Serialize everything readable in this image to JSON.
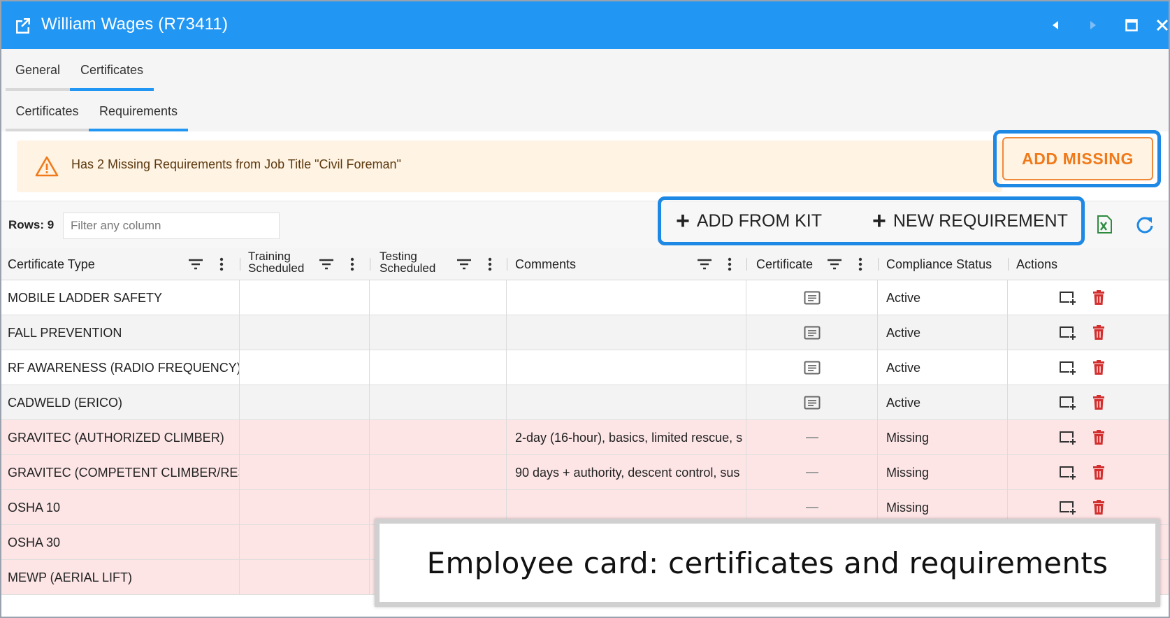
{
  "window": {
    "title": "William Wages (R73411)",
    "open_icon": "open-in-new-icon",
    "controls": [
      "prev-record-icon",
      "next-record-icon",
      "maximize-icon",
      "close-icon"
    ]
  },
  "tabs": {
    "top": [
      {
        "label": "General",
        "active": false
      },
      {
        "label": "Certificates",
        "active": true
      }
    ],
    "sub": [
      {
        "label": "Certificates",
        "active": false
      },
      {
        "label": "Requirements",
        "active": true
      }
    ]
  },
  "alert": {
    "icon": "warning-icon",
    "message": "Has 2 Missing Requirements from Job Title \"Civil Foreman\"",
    "action_label": "ADD MISSING",
    "colors": {
      "background": "#fff3e3",
      "accent": "#f07a1a"
    }
  },
  "toolbar": {
    "rows_label": "Rows: 9",
    "filter_placeholder": "Filter any column",
    "add_from_kit_label": "ADD FROM KIT",
    "new_requirement_label": "NEW REQUIREMENT",
    "export_icon": "excel-export-icon",
    "refresh_icon": "refresh-icon"
  },
  "table": {
    "headers": {
      "certificate_type": "Certificate Type",
      "training_line1": "Training",
      "training_line2": "Scheduled",
      "testing_line1": "Testing",
      "testing_line2": "Scheduled",
      "comments": "Comments",
      "certificate": "Certificate",
      "compliance_status": "Compliance Status",
      "actions": "Actions"
    },
    "rows": [
      {
        "certificate_type": "MOBILE LADDER SAFETY",
        "training": "",
        "testing": "",
        "comments": "",
        "certificate": "document-icon",
        "status": "Active"
      },
      {
        "certificate_type": "FALL PREVENTION",
        "training": "",
        "testing": "",
        "comments": "",
        "certificate": "document-icon",
        "status": "Active"
      },
      {
        "certificate_type": "RF AWARENESS (RADIO FREQUENCY)",
        "training": "",
        "testing": "",
        "comments": "",
        "certificate": "document-icon",
        "status": "Active"
      },
      {
        "certificate_type": "CADWELD (ERICO)",
        "training": "",
        "testing": "",
        "comments": "",
        "certificate": "document-icon",
        "status": "Active"
      },
      {
        "certificate_type": "GRAVITEC (AUTHORIZED CLIMBER)",
        "training": "",
        "testing": "",
        "comments": "2-day (16-hour), basics, limited rescue, s",
        "certificate": "dash",
        "status": "Missing"
      },
      {
        "certificate_type": "GRAVITEC (COMPETENT CLIMBER/RESCU",
        "training": "",
        "testing": "",
        "comments": "90 days + authority, descent control, sus",
        "certificate": "dash",
        "status": "Missing"
      },
      {
        "certificate_type": "OSHA 10",
        "training": "",
        "testing": "",
        "comments": "",
        "certificate": "dash",
        "status": "Missing"
      },
      {
        "certificate_type": "OSHA 30",
        "training": "",
        "testing": "",
        "comments": "",
        "certificate": "",
        "status": ""
      },
      {
        "certificate_type": "MEWP (AERIAL LIFT)",
        "training": "",
        "testing": "",
        "comments": "",
        "certificate": "",
        "status": ""
      }
    ],
    "row_actions": [
      "edit-add-icon",
      "delete-icon"
    ],
    "colors": {
      "missing_row": "#fde5e6",
      "delete": "#d32f2f",
      "tab_accent": "#2196f3"
    }
  },
  "caption": {
    "text": "Employee card: certificates and requirements"
  }
}
